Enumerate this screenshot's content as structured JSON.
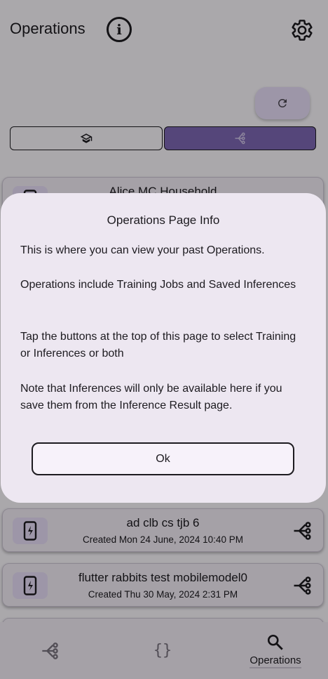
{
  "appbar": {
    "title": "Operations",
    "info_icon": "info-icon",
    "settings_icon": "gear-icon"
  },
  "toolbar": {
    "refresh_icon": "refresh-icon",
    "filter_training_icon": "graduation-cap-icon",
    "filter_inference_icon": "inference-branch-icon",
    "inference_selected": true
  },
  "operations": [
    {
      "name": "Alice MC Household",
      "date": "",
      "thumb_icon": "phone-charging-icon",
      "kind_icon": "more-vert-icon"
    },
    {
      "name": "ad clb cs tjb 6",
      "date": "Created Mon 24 June, 2024 10:40 PM",
      "thumb_icon": "phone-charging-icon",
      "kind_icon": "inference-branch-icon"
    },
    {
      "name": "flutter rabbits test mobilemodel0",
      "date": "Created Thu 30 May, 2024 2:31 PM",
      "thumb_icon": "phone-charging-icon",
      "kind_icon": "inference-branch-icon"
    }
  ],
  "navbar": {
    "items": [
      {
        "icon": "inference-branch-icon",
        "label": ""
      },
      {
        "icon": "braces-icon",
        "label": ""
      },
      {
        "icon": "search-zoom-icon",
        "label": "Operations"
      }
    ]
  },
  "dialog": {
    "title": "Operations Page Info",
    "p1": "This is where you can view your past Operations.",
    "p2": "Operations include Training Jobs and Saved Inferences",
    "p3": "Tap the buttons at the top of this page to select Training or Inferences or both",
    "p4": "Note that Inferences will only be available here if you save them from the Inference Result page.",
    "ok_label": "Ok"
  },
  "colors": {
    "accent": "#7e67b4",
    "surface": "#f3edf7",
    "dialog": "#ede7f1"
  }
}
